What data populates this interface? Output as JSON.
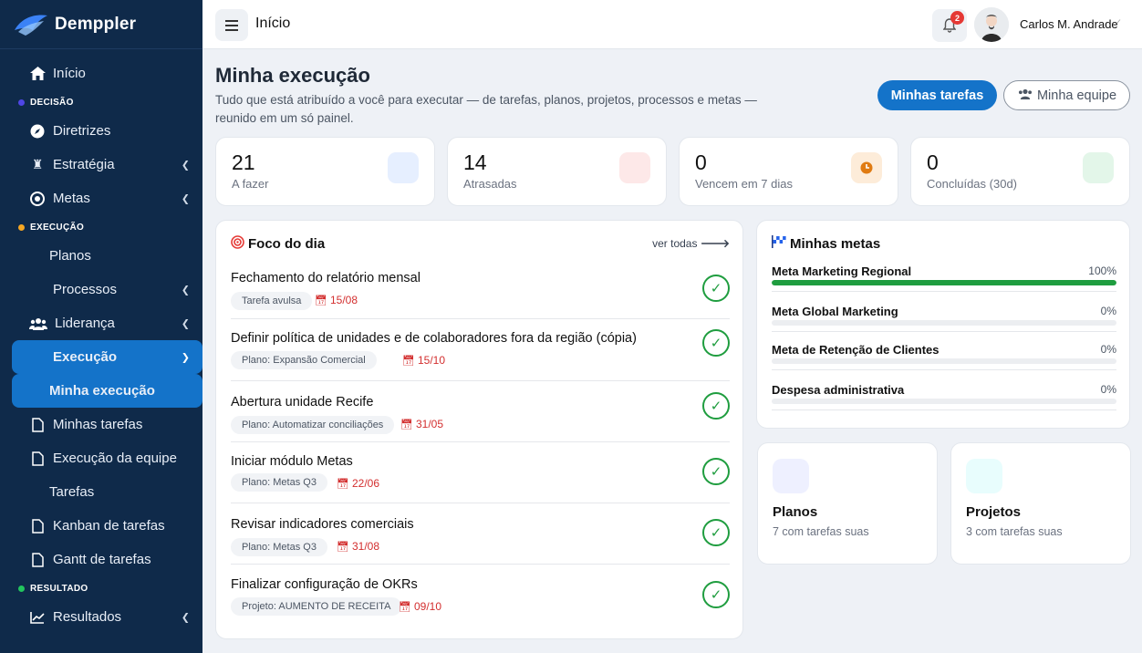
{
  "brand": {
    "name": "Demppler"
  },
  "sidebar": {
    "items": [
      {
        "label": "Início"
      },
      {
        "section": "DECISÃO",
        "color": "#4f46e5"
      },
      {
        "label": "Diretrizes"
      },
      {
        "label": "Estratégia"
      },
      {
        "label": "Metas"
      },
      {
        "section": "EXECUÇÃO",
        "color": "#f5a623"
      },
      {
        "label": "Planos"
      },
      {
        "label": "Processos"
      },
      {
        "label": "Liderança"
      },
      {
        "label": "Execução"
      },
      {
        "label": "Minha execução"
      },
      {
        "label": "Minhas tarefas"
      },
      {
        "label": "Execução da equipe"
      },
      {
        "label": "Tarefas"
      },
      {
        "label": "Kanban de tarefas"
      },
      {
        "label": "Gantt de tarefas"
      },
      {
        "section": "RESULTADO",
        "color": "#22c55e"
      },
      {
        "label": "Resultados"
      }
    ]
  },
  "topbar": {
    "title": "Início",
    "notifications": "2",
    "user_name": "Carlos M. Andrade"
  },
  "page": {
    "title": "Minha execução",
    "subtitle": "Tudo que está atribuído a você para executar — de tarefas, planos, projetos, processos e metas — reunido em um só painel.",
    "btn_my_tasks": "Minhas tarefas",
    "btn_my_team": "Minha equipe"
  },
  "stats": [
    {
      "value": "21",
      "label": "A fazer",
      "color": "#e6efff"
    },
    {
      "value": "14",
      "label": "Atrasadas",
      "color": "#fde8e8"
    },
    {
      "value": "0",
      "label": "Vencem em 7 dias",
      "color": "#fdecd9"
    },
    {
      "value": "0",
      "label": "Concluídas (30d)",
      "color": "#e3f6e9"
    }
  ],
  "focus": {
    "title": "Foco do dia",
    "see_all": "ver todas",
    "tasks": [
      {
        "name": "Fechamento do relatório mensal",
        "tag": "Tarefa avulsa",
        "date": "15/08"
      },
      {
        "name": "Definir política de unidades e de colaboradores fora da região (cópia)",
        "tag": "Plano: Expansão Comercial",
        "date": "15/10"
      },
      {
        "name": "Abertura unidade Recife",
        "tag": "Plano: Automatizar conciliações",
        "date": "31/05"
      },
      {
        "name": "Iniciar módulo Metas",
        "tag": "Plano: Metas Q3",
        "date": "22/06"
      },
      {
        "name": "Revisar indicadores comerciais",
        "tag": "Plano: Metas Q3",
        "date": "31/08"
      },
      {
        "name": "Finalizar configuração de OKRs",
        "tag": "Projeto: AUMENTO DE RECEITA",
        "date": "09/10"
      }
    ]
  },
  "goals": {
    "title": "Minhas metas",
    "items": [
      {
        "name": "Meta Marketing Regional",
        "pct_label": "100%",
        "progress": 100
      },
      {
        "name": "Meta Global Marketing",
        "pct_label": "0%",
        "progress": 0
      },
      {
        "name": "Meta de Retenção de Clientes",
        "pct_label": "0%",
        "progress": 0
      },
      {
        "name": "Despesa administrativa",
        "pct_label": "0%",
        "progress": 0
      }
    ]
  },
  "cards": [
    {
      "title": "Planos",
      "subtitle": "7 com tarefas suas",
      "color": "#eef0ff"
    },
    {
      "title": "Projetos",
      "subtitle": "3 com tarefas suas",
      "color": "#e8fdfd"
    }
  ]
}
